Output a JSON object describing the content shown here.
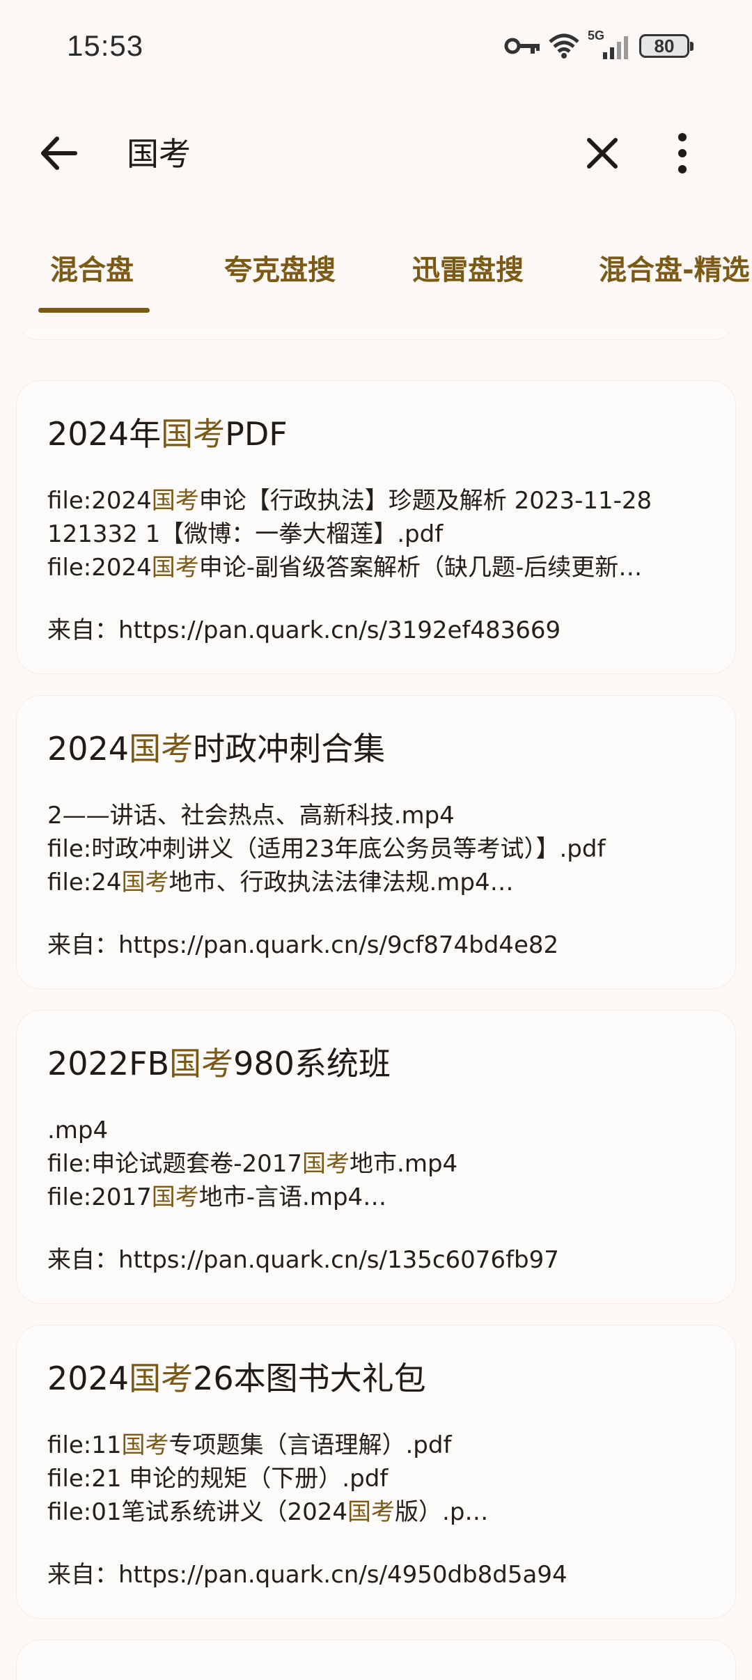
{
  "status_bar": {
    "time": "15:53",
    "network": "5G",
    "battery": "80"
  },
  "app_bar": {
    "search_query": "国考",
    "back_icon": "arrow-left-icon",
    "clear_icon": "close-icon",
    "more_icon": "more-vert-icon"
  },
  "tabs": [
    {
      "label": "混合盘",
      "selected": true
    },
    {
      "label": "夸克盘搜",
      "selected": false
    },
    {
      "label": "迅雷盘搜",
      "selected": false
    },
    {
      "label": "混合盘-精选",
      "selected": false
    }
  ],
  "results": [
    {
      "title": "2024年国考PDF",
      "lines": [
        "file:2024国考申论【行政执法】珍题及解析 2023-11-28",
        "121332 1【微博：一拳大榴莲】.pdf",
        "file:2024国考申论-副省级答案解析（缺几题-后续更新…"
      ],
      "source": "来自：https://pan.quark.cn/s/3192ef483669"
    },
    {
      "title": "2024国考时政冲刺合集",
      "lines": [
        "2——讲话、社会热点、高新科技.mp4",
        "file:时政冲刺讲义（适用23年底公务员等考试）】.pdf",
        "file:24国考地市、行政执法法律法规.mp4…"
      ],
      "source": "来自：https://pan.quark.cn/s/9cf874bd4e82"
    },
    {
      "title": "2022FB国考980系统班",
      "lines": [
        ".mp4",
        "file:申论试题套卷-2017国考地市.mp4",
        "file:2017国考地市-言语.mp4…"
      ],
      "source": "来自：https://pan.quark.cn/s/135c6076fb97"
    },
    {
      "title": "2024国考26本图书大礼包",
      "lines": [
        "file:11国考专项题集（言语理解）.pdf",
        "file:21 申论的规矩（下册）.pdf",
        "file:01笔试系统讲义（2024国考版）.p…"
      ],
      "source": "来自：https://pan.quark.cn/s/4950db8d5a94"
    }
  ],
  "colors": {
    "accent": "#7a5a14",
    "background": "#fbf8f6",
    "card": "#fdfbfa",
    "text": "#1f1b16"
  }
}
